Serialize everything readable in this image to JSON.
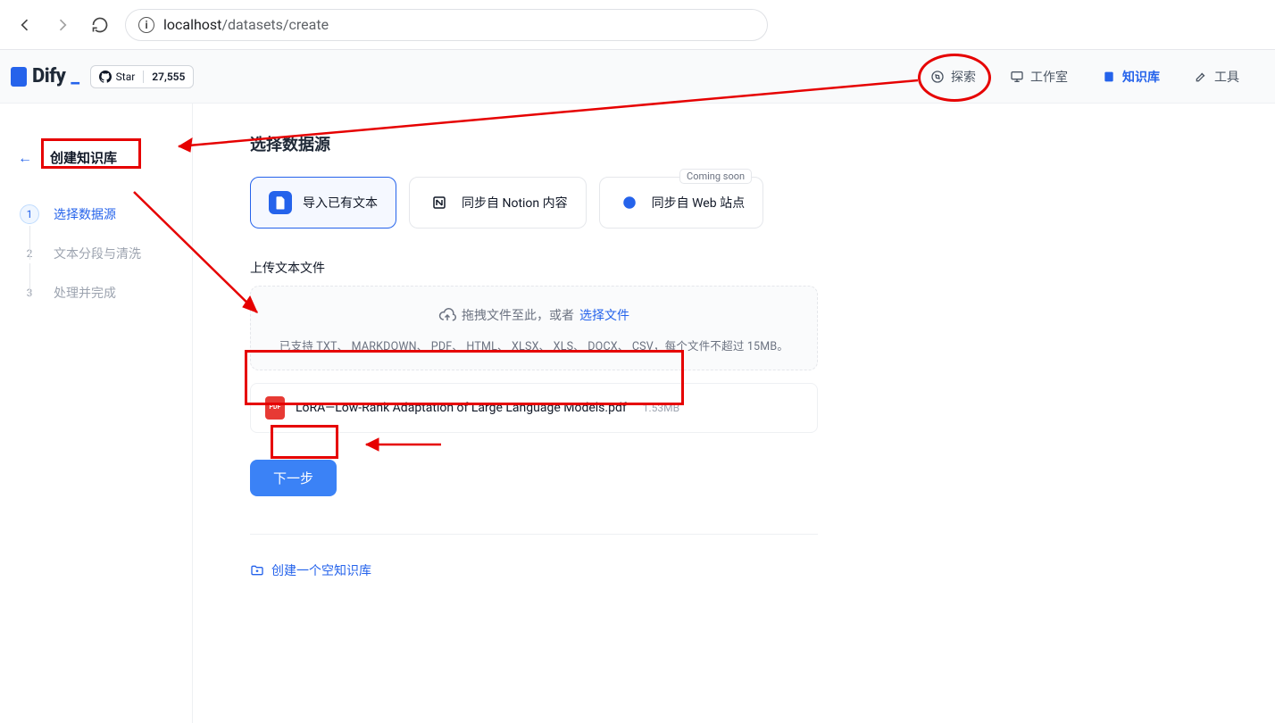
{
  "browser": {
    "url_host": "localhost",
    "url_path": "/datasets/create"
  },
  "header": {
    "brand": "Dify",
    "star_label": "Star",
    "star_count": "27,555",
    "nav": {
      "explore": "探索",
      "studio": "工作室",
      "knowledge": "知识库",
      "tools": "工具"
    }
  },
  "sidebar": {
    "back_title": "创建知识库",
    "steps": [
      {
        "num": "1",
        "label": "选择数据源"
      },
      {
        "num": "2",
        "label": "文本分段与清洗"
      },
      {
        "num": "3",
        "label": "处理并完成"
      }
    ]
  },
  "main": {
    "heading": "选择数据源",
    "options": {
      "import_text": "导入已有文本",
      "sync_notion": "同步自 Notion 内容",
      "sync_web": "同步自 Web 站点",
      "coming_soon": "Coming soon"
    },
    "upload": {
      "section_title": "上传文本文件",
      "drop_prefix": "拖拽文件至此，或者",
      "choose_file": "选择文件",
      "supported": "已支持 TXT、 MARKDOWN、 PDF、 HTML、 XLSX、 XLS、 DOCX、 CSV，每个文件不超过 15MB。",
      "file_name": "LoRA—Low-Rank Adaptation of Large Language Models.pdf",
      "file_size": "1.53MB"
    },
    "next_btn": "下一步",
    "create_empty": "创建一个空知识库"
  }
}
